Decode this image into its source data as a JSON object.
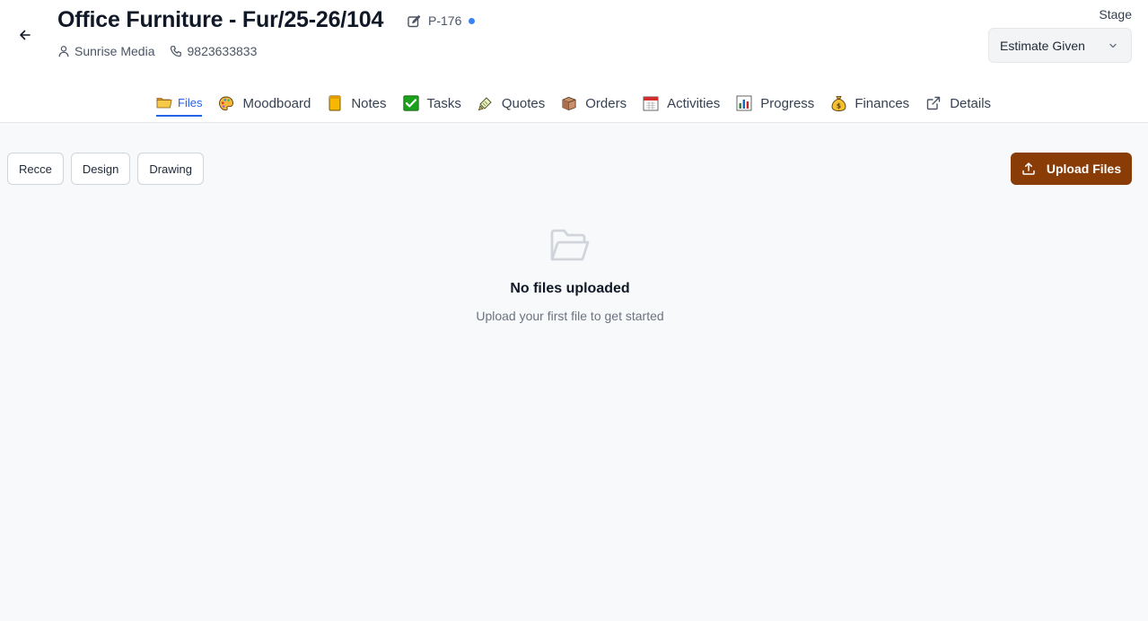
{
  "header": {
    "title": "Office Furniture - Fur/25-26/104",
    "project_code": "P-176",
    "client_name": "Sunrise Media",
    "phone": "9823633833",
    "status_dot_color": "#3b82f6"
  },
  "stage": {
    "label": "Stage",
    "selected": "Estimate Given"
  },
  "tabs": [
    {
      "label": "Files",
      "icon": "folder-icon",
      "active": true
    },
    {
      "label": "Moodboard",
      "icon": "palette-icon",
      "active": false
    },
    {
      "label": "Notes",
      "icon": "note-icon",
      "active": false
    },
    {
      "label": "Tasks",
      "icon": "checkbox-icon",
      "active": false
    },
    {
      "label": "Quotes",
      "icon": "pencil-paper-icon",
      "active": false
    },
    {
      "label": "Orders",
      "icon": "package-icon",
      "active": false
    },
    {
      "label": "Activities",
      "icon": "calendar-icon",
      "active": false
    },
    {
      "label": "Progress",
      "icon": "bar-chart-icon",
      "active": false
    },
    {
      "label": "Finances",
      "icon": "money-bag-icon",
      "active": false
    },
    {
      "label": "Details",
      "icon": "external-link-icon",
      "active": false
    }
  ],
  "filters": [
    "Recce",
    "Design",
    "Drawing"
  ],
  "upload_button": "Upload Files",
  "empty_state": {
    "title": "No files uploaded",
    "subtitle": "Upload your first file to get started"
  },
  "colors": {
    "accent": "#2563eb",
    "upload_button": "#8a3c06"
  }
}
